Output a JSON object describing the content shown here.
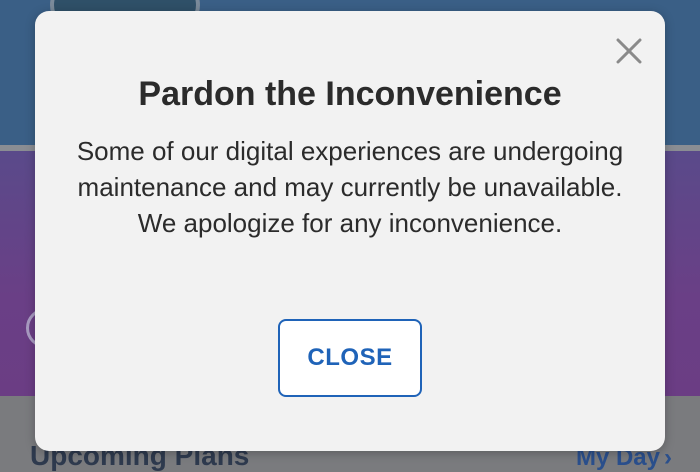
{
  "background": {
    "section_title": "Upcoming Plans",
    "link_label": "My Day",
    "link_chevron": "›",
    "chevron_right": "›"
  },
  "modal": {
    "title": "Pardon the Inconvenience",
    "body": "Some of our digital experiences are undergoing maintenance and may currently be unavailable. We apologize for any inconvenience.",
    "close_button_label": "CLOSE",
    "dismiss_icon": "close-icon"
  },
  "colors": {
    "accent": "#1f63b8",
    "modal_bg": "#f2f2f2",
    "text": "#2b2b2b"
  }
}
